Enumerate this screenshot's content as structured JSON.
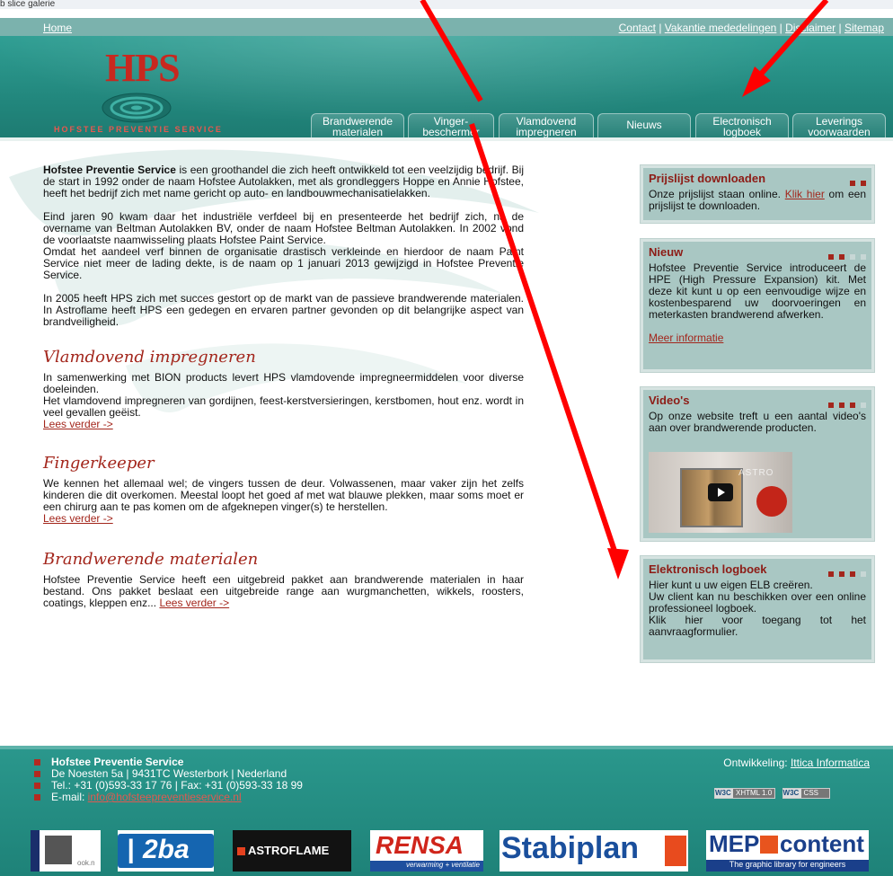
{
  "browser_tab": "b slice galerie",
  "toplinks": {
    "home": "Home",
    "contact": "Contact",
    "vakantie": "Vakantie mededelingen",
    "disclaimer": "Disclaimer",
    "sitemap": "Sitemap",
    "sep": "|"
  },
  "logo": {
    "mark": "HPS",
    "subtitle": "HOFSTEE PREVENTIE SERVICE"
  },
  "nav": [
    {
      "line1": "Brandwerende",
      "line2": "materialen"
    },
    {
      "line1": "Vinger-",
      "line2": "beschermer"
    },
    {
      "line1": "Vlamdovend",
      "line2": "impregneren"
    },
    {
      "line1": "Nieuws",
      "line2": ""
    },
    {
      "line1": "Electronisch",
      "line2": "logboek"
    },
    {
      "line1": "Leverings",
      "line2": "voorwaarden"
    }
  ],
  "intro": {
    "p1_bold": "Hofstee Preventie Service",
    "p1": " is een groothandel die zich heeft ontwikkeld tot een veelzijdig bedrijf. Bij de start in 1992 onder de naam Hofstee Autolakken, met als grondleggers Hoppe en Annie Hofstee, heeft het bedrijf zich met name gericht op auto- en landbouwmechanisatielakken.",
    "p2": "Eind jaren 90 kwam daar het industriële verfdeel bij en presenteerde het bedrijf zich, na de overname van Beltman Autolakken BV, onder de naam Hofstee Beltman Autolakken. In 2002 vond de voorlaatste naamwisseling plaats Hofstee Paint Service.",
    "p2b": "Omdat het aandeel verf binnen de organisatie drastisch verkleinde en hierdoor de naam Paint Service niet meer de lading dekte, is de naam op 1 januari 2013 gewijzigd in Hofstee Preventie Service.",
    "p3": "In 2005 heeft HPS zich met succes gestort op de markt van de passieve brandwerende materialen. In Astroflame heeft HPS een gedegen en ervaren partner gevonden op dit belangrijke aspect van brandveiligheid."
  },
  "sections": {
    "vlam_title": "Vlamdovend impregneren",
    "vlam_p1": "In samenwerking met BION products levert HPS vlamdovende impregneermiddelen voor diverse doeleinden.",
    "vlam_p2": "Het vlamdovend impregneren van gordijnen, feest-kerstversieringen, kerstbomen, hout enz. wordt in veel gevallen geëist.",
    "finger_title": "Fingerkeeper",
    "finger_p": "We kennen het allemaal wel; de vingers tussen de deur. Volwassenen, maar vaker zijn het zelfs kinderen die dit overkomen. Meestal loopt het goed af met wat blauwe plekken, maar soms moet er een chirurg aan te pas komen om de afgeknepen vinger(s) te herstellen.",
    "brand_title": "Brandwerende materialen",
    "brand_p": "Hofstee Preventie Service heeft een uitgebreid pakket aan brandwerende materialen in haar bestand. Ons pakket beslaat een uitgebreide range aan wurgmanchetten, wikkels, roosters, coatings, kleppen enz...",
    "read_more": "Lees verder ->"
  },
  "sidebar": {
    "prijslijst_title": "Prijslijst downloaden",
    "prijslijst_pre": "Onze prijslijst staan online.",
    "prijslijst_link": "Klik hier",
    "prijslijst_post": " om een prijslijst te downloaden.",
    "nieuw_title": "Nieuw",
    "nieuw_text": "Hofstee Preventie Service introduceert de HPE (High Pressure Expansion) kit. Met deze kit kunt u op een eenvoudige wijze en kostenbesparend uw doorvoeringen en meterkasten brandwerend afwerken.",
    "nieuw_link": "Meer informatie",
    "video_title": "Video's",
    "video_text": "Op onze website treft u een aantal video's aan over brandwerende producten.",
    "video_brand": "ASTRO",
    "elb_title": "Elektronisch logboek",
    "elb_text1": "Hier kunt u uw eigen ELB creëren.",
    "elb_text2": "Uw client kan nu beschikken over een online professioneel logboek.",
    "elb_text3": "Klik hier voor toegang tot het aanvraagformulier."
  },
  "footer": {
    "company": "Hofstee Preventie Service",
    "address": "De Noesten 5a | 9431TC Westerbork | Nederland",
    "phone": "Tel.: +31 (0)593-33 17 76 | Fax: +31 (0)593-33 18 99",
    "email_label": "E-mail: ",
    "email": "info@hofsteepreventieservice.nl",
    "dev_label": "Ontwikkeling: ",
    "dev_link": "Ittica Informatica",
    "w3c1_a": "W3C",
    "w3c1_b": "XHTML 1.0",
    "w3c2_a": "W3C",
    "w3c2_b": "CSS"
  },
  "logos": {
    "l1": "ook.n",
    "l2": "2ba",
    "l3": "ASTROFLAME",
    "l4": "RENSA",
    "l4_sub": "verwarming + ventilatie",
    "l5": "Stabiplan",
    "l6": "MEP",
    "l6b": "content",
    "l6_sub": "The graphic library for engineers"
  },
  "colors": {
    "brand_red": "#a3261c",
    "teal": "#22877d",
    "sidebar_bg": "#a9c7c3",
    "annotation_arrow": "#ff0000"
  }
}
